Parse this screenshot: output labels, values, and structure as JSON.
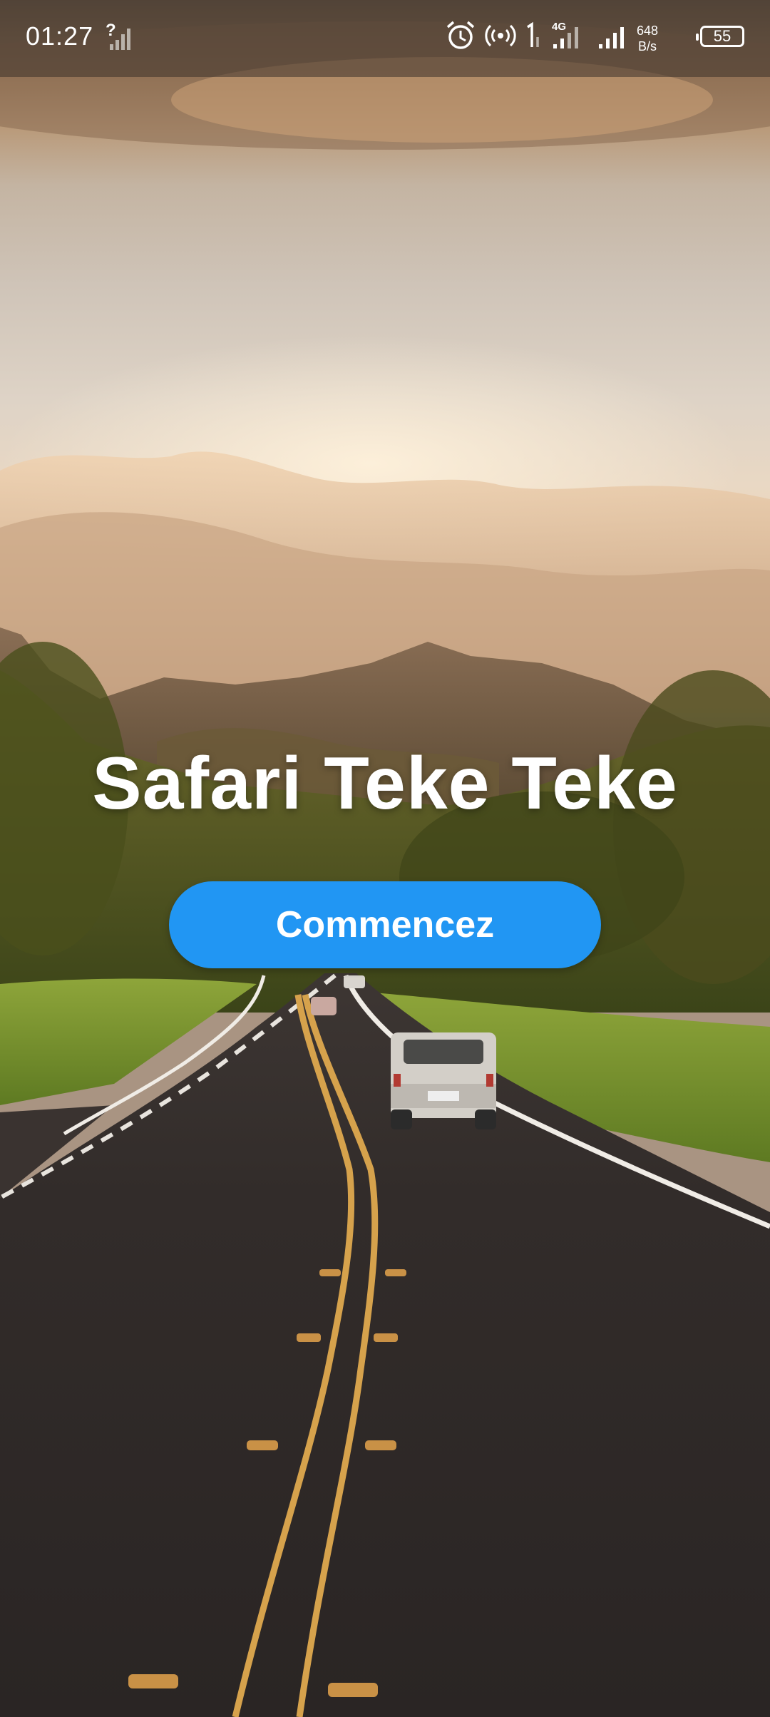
{
  "status_bar": {
    "time": "01:27",
    "unknown_signal_icon": "signal-unknown-icon",
    "icons": [
      "alarm-icon",
      "hotspot-icon",
      "sim1-signal-icon",
      "4g-signal-icon",
      "signal-icon"
    ],
    "network_type": "4G",
    "net_speed_value": "648",
    "net_speed_unit": "B/s",
    "battery_level": "55"
  },
  "main": {
    "title": "Safari Teke Teke",
    "start_button_label": "Commencez"
  },
  "colors": {
    "accent": "#2196f3",
    "title_text": "#ffffff"
  }
}
